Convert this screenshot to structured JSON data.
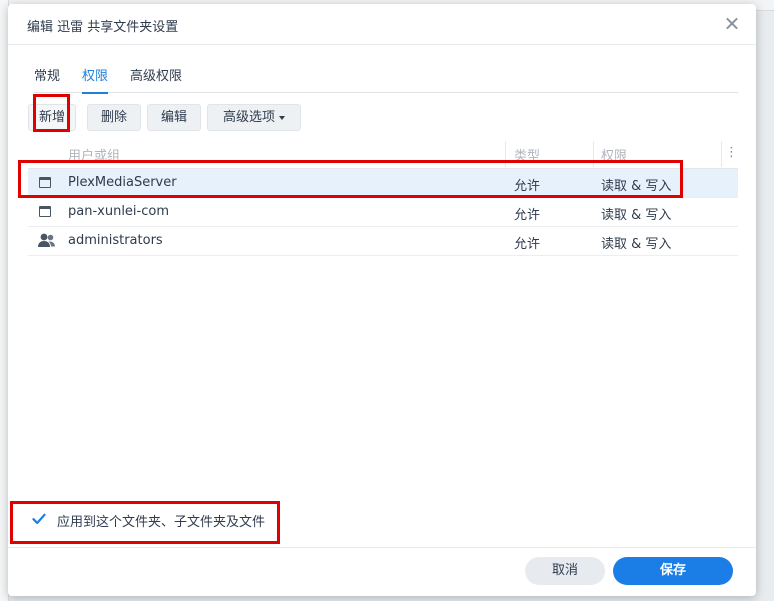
{
  "dialog": {
    "title": "编辑 迅雷 共享文件夹设置",
    "close_icon": "close-icon"
  },
  "tabs": [
    {
      "label": "常规",
      "active": false
    },
    {
      "label": "权限",
      "active": true
    },
    {
      "label": "高级权限",
      "active": false
    }
  ],
  "toolbar": {
    "add_label": "新增",
    "delete_label": "删除",
    "edit_label": "编辑",
    "advanced_label": "高级选项"
  },
  "table": {
    "columns": [
      "用户或组",
      "类型",
      "权限"
    ],
    "rows": [
      {
        "icon": "user-icon",
        "name": "PlexMediaServer",
        "type": "允许",
        "permission": "读取 & 写入",
        "selected": true
      },
      {
        "icon": "user-icon",
        "name": "pan-xunlei-com",
        "type": "允许",
        "permission": "读取 & 写入",
        "selected": false
      },
      {
        "icon": "group-icon",
        "name": "administrators",
        "type": "允许",
        "permission": "读取 & 写入",
        "selected": false
      }
    ]
  },
  "apply": {
    "label": "应用到这个文件夹、子文件夹及文件",
    "checked": true
  },
  "footer": {
    "cancel_label": "取消",
    "save_label": "保存"
  },
  "colors": {
    "accent": "#1a7ee6",
    "highlight": "#e00000",
    "selected_row": "#e6f1fb"
  }
}
